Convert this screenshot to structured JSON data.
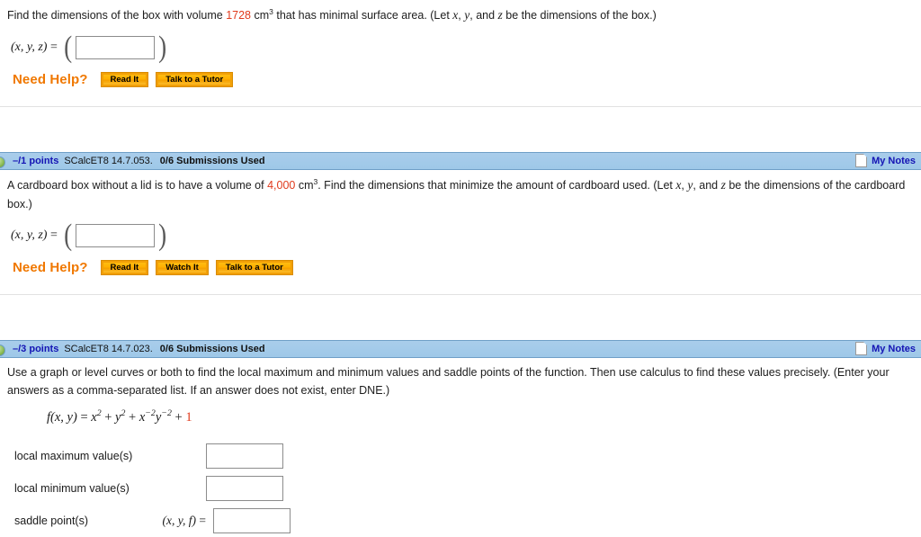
{
  "questions": [
    {
      "id": "q-partial-top",
      "prompt_parts": {
        "before_number": "Find the dimensions of the box with volume ",
        "number": "1728",
        "unit": "cm",
        "unit_exponent": "3",
        "after_unit": " that has minimal surface area. (Let ",
        "var1": "x",
        "sep1": ", ",
        "var2": "y",
        "sep2": ", and ",
        "var3": "z",
        "tail": " be the dimensions of the box.)"
      },
      "answer": {
        "label_open": "(",
        "label_vars": "x, y, z",
        "label_close": ")",
        "equals": "=",
        "open_paren": "(",
        "close_paren": ")",
        "value": "",
        "placeholder": ""
      },
      "need_help": {
        "label": "Need Help?",
        "buttons": [
          "Read It",
          "Talk to a Tutor"
        ]
      }
    },
    {
      "id": "q-14-7-053",
      "header": {
        "toggle_icon": "collapse-toggle-icon",
        "points": "–/1 points",
        "code": "SCalcET8 14.7.053.",
        "submissions": "0/6 Submissions Used",
        "notes_icon": "note-page-icon",
        "notes_label": "My Notes"
      },
      "prompt_parts": {
        "before_number": "A cardboard box without a lid is to have a volume of ",
        "number": "4,000",
        "unit": "cm",
        "unit_exponent": "3",
        "after_unit": ". Find the dimensions that minimize the amount of cardboard used. (Let ",
        "var1": "x",
        "sep1": ", ",
        "var2": "y",
        "sep2": ", and ",
        "var3": "z",
        "tail": " be the dimensions of the cardboard box.)"
      },
      "answer": {
        "label_vars": "x, y, z",
        "equals": "=",
        "open_paren": "(",
        "close_paren": ")",
        "value": "",
        "placeholder": ""
      },
      "need_help": {
        "label": "Need Help?",
        "buttons": [
          "Read It",
          "Watch It",
          "Talk to a Tutor"
        ]
      }
    },
    {
      "id": "q-14-7-023",
      "header": {
        "toggle_icon": "collapse-toggle-icon",
        "points": "–/3 points",
        "code": "SCalcET8 14.7.023.",
        "submissions": "0/6 Submissions Used",
        "notes_icon": "note-page-icon",
        "notes_label": "My Notes"
      },
      "prompt": "Use a graph or level curves or both to find the local maximum and minimum values and saddle points of the function. Then use calculus to find these values precisely. (Enter your answers as a comma-separated list. If an answer does not exist, enter DNE.)",
      "function": {
        "name": "f",
        "args": "(x, y)",
        "equals": " = ",
        "term1": "x",
        "term1_exp": "2",
        "plus1": " + ",
        "term2": "y",
        "term2_exp": "2",
        "plus2": " + ",
        "term3a": "x",
        "term3a_exp": "−2",
        "term3b": "y",
        "term3b_exp": "−2",
        "plus3": " + ",
        "constant": "1"
      },
      "rows": [
        {
          "label": "local maximum value(s)",
          "prefix": "",
          "value": "",
          "placeholder": ""
        },
        {
          "label": "local minimum value(s)",
          "prefix": "",
          "value": "",
          "placeholder": ""
        },
        {
          "label": "saddle point(s)",
          "prefix_vars": "(x, y, f)",
          "prefix_eq": "=",
          "value": "",
          "placeholder": ""
        }
      ]
    }
  ],
  "colors": {
    "header_blue": "#a9cdeb",
    "points_blue": "#1414b4",
    "accent_red": "#e03a1c",
    "need_help_orange": "#f07800",
    "button_gold": "#ffb000"
  }
}
